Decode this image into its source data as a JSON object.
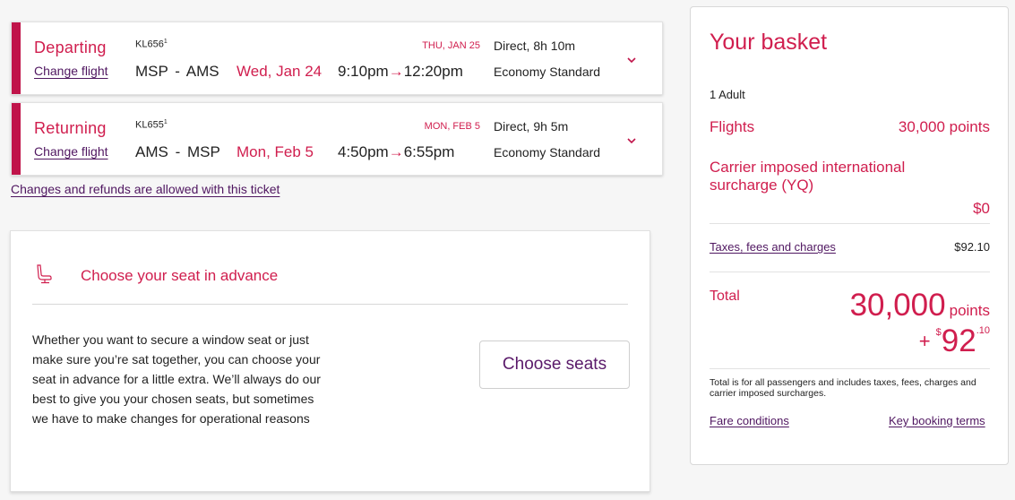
{
  "colors": {
    "accent": "#d01e4e",
    "accent_bar": "#c0144a",
    "link": "#4f1660",
    "background": "#f6f6f6"
  },
  "flights": [
    {
      "direction": "Departing",
      "change_label": "Change flight",
      "flight_number": "KL656",
      "footnote": "1",
      "origin": "MSP",
      "separator": "-",
      "destination": "AMS",
      "date": "Wed, Jan 24",
      "depart_time": "9:10pm",
      "arrow": "→",
      "arrive_time": "12:20pm",
      "arrival_date": "THU, JAN 25",
      "duration": "Direct, 8h 10m",
      "cabin": "Economy Standard",
      "expand_icon": "chevron-down-icon"
    },
    {
      "direction": "Returning",
      "change_label": "Change flight",
      "flight_number": "KL655",
      "footnote": "1",
      "origin": "AMS",
      "separator": "-",
      "destination": "MSP",
      "date": "Mon, Feb 5",
      "depart_time": "4:50pm",
      "arrow": "→",
      "arrive_time": "6:55pm",
      "arrival_date": "MON, FEB 5",
      "duration": "Direct, 9h 5m",
      "cabin": "Economy Standard",
      "expand_icon": "chevron-down-icon"
    }
  ],
  "refund_link": "Changes and refunds are allowed with this ticket",
  "seat_section": {
    "icon": "seat-icon",
    "title": "Choose your seat in advance",
    "description": "Whether you want to secure a window seat or just make sure you’re sat together, you can choose your seat in advance for a little extra. We’ll always do our best to give you your chosen seats, but sometimes we have to make changes for operational reasons",
    "button_label": "Choose seats"
  },
  "basket": {
    "title": "Your basket",
    "passengers": "1 Adult",
    "flights_label": "Flights",
    "flights_value": "30,000 points",
    "yq_label": "Carrier imposed international surcharge (YQ)",
    "yq_value": "$0",
    "taxes_label": "Taxes, fees and charges",
    "taxes_value": "$92.10",
    "total_label": "Total",
    "total_points": "30,000",
    "total_points_unit": "points",
    "total_plus": "+",
    "total_currency": "$",
    "total_cash_whole": "92",
    "total_cash_cents": ".10",
    "note": "Total is for all passengers and includes taxes, fees, charges and carrier imposed surcharges.",
    "fare_conditions_link": "Fare conditions",
    "booking_terms_link": "Key booking terms"
  }
}
